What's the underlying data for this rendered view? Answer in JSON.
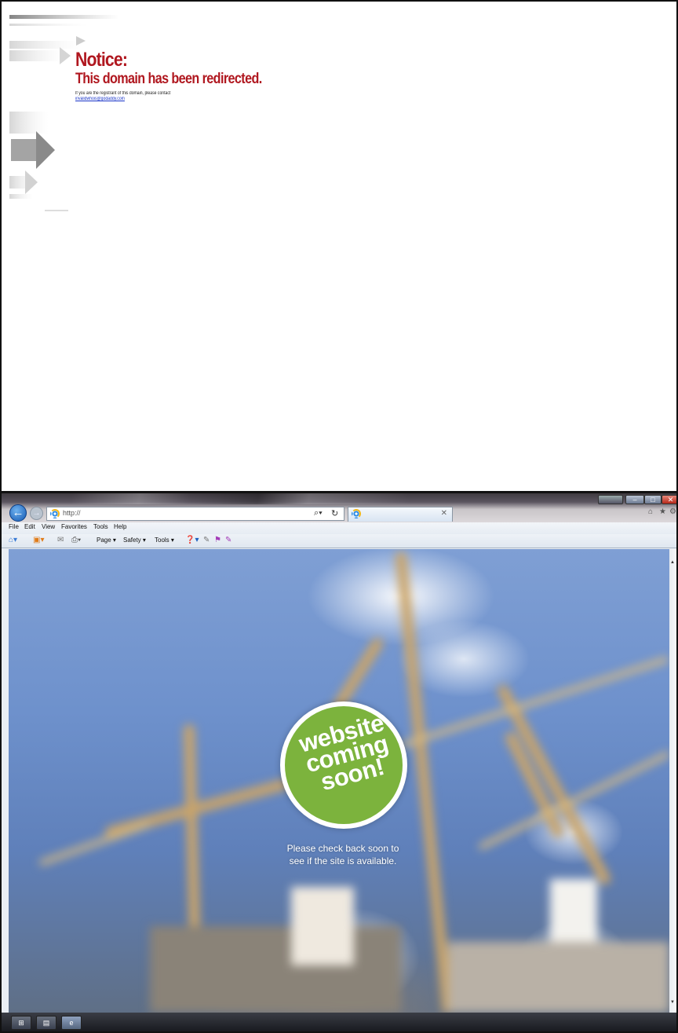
{
  "notice": {
    "title": "Notice:",
    "subtitle": "This domain has been redirected.",
    "text": "If you are the registrant of this domain, please contact",
    "email": "invalidwhois@godaddy.com"
  },
  "browser": {
    "address": "http://",
    "menu": [
      "File",
      "Edit",
      "View",
      "Favorites",
      "Tools",
      "Help"
    ],
    "commands": {
      "page": "Page ▾",
      "safety": "Safety ▾",
      "tools": "Tools ▾"
    }
  },
  "page": {
    "badge_lines": [
      "website",
      "coming",
      "soon!"
    ],
    "caption_line1": "Please check back soon to",
    "caption_line2": "see if the site is available."
  },
  "icons": {
    "back": "back-arrow-icon",
    "forward": "forward-arrow-icon",
    "search": "search-icon",
    "refresh": "refresh-icon",
    "close": "close-icon",
    "home": "home-icon",
    "favorites": "star-icon",
    "settings": "gear-icon"
  },
  "colors": {
    "notice_red": "#b0171f",
    "badge_green": "#7cb33d",
    "link_blue": "#1a35c8"
  }
}
